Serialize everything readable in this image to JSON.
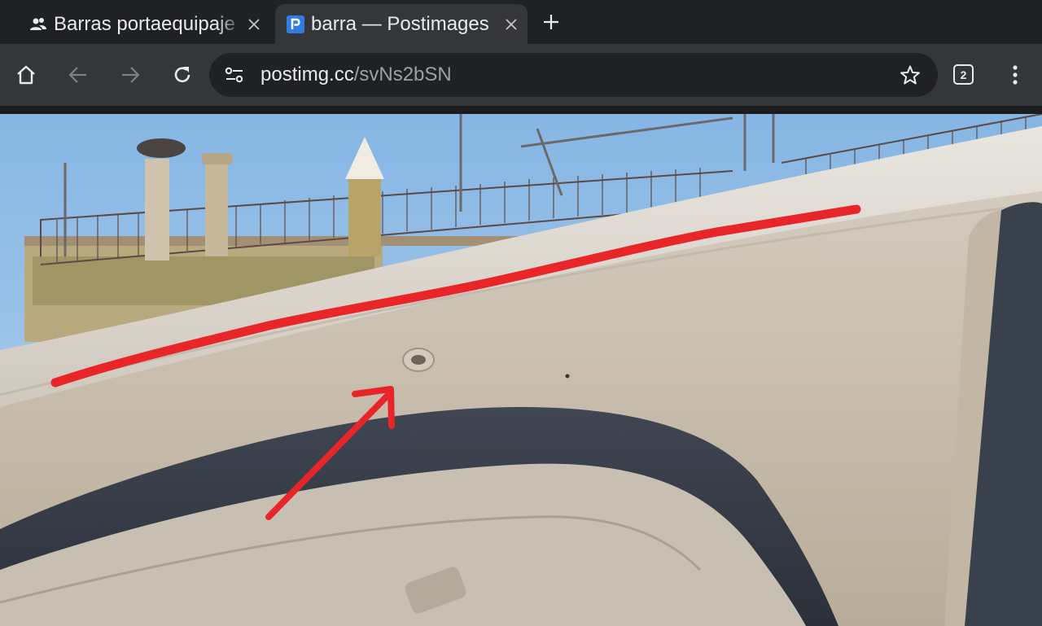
{
  "tabs": [
    {
      "title": "Barras portaequipaje",
      "icon": "group-icon",
      "active": false
    },
    {
      "title": "barra — Postimages",
      "icon": "postimages-favicon-icon",
      "active": true
    }
  ],
  "toolbar": {
    "url_host": "postimg.cc",
    "url_path": "/svNs2bSN",
    "tab_count": "2"
  },
  "content": {
    "type": "photo",
    "description_icons": [
      "red-line-annotation",
      "red-arrow-annotation"
    ]
  },
  "colors": {
    "tabstrip_bg": "#202124",
    "toolbar_bg": "#35363a",
    "omnibox_bg": "#202124",
    "annotation_red": "#e8262a"
  }
}
